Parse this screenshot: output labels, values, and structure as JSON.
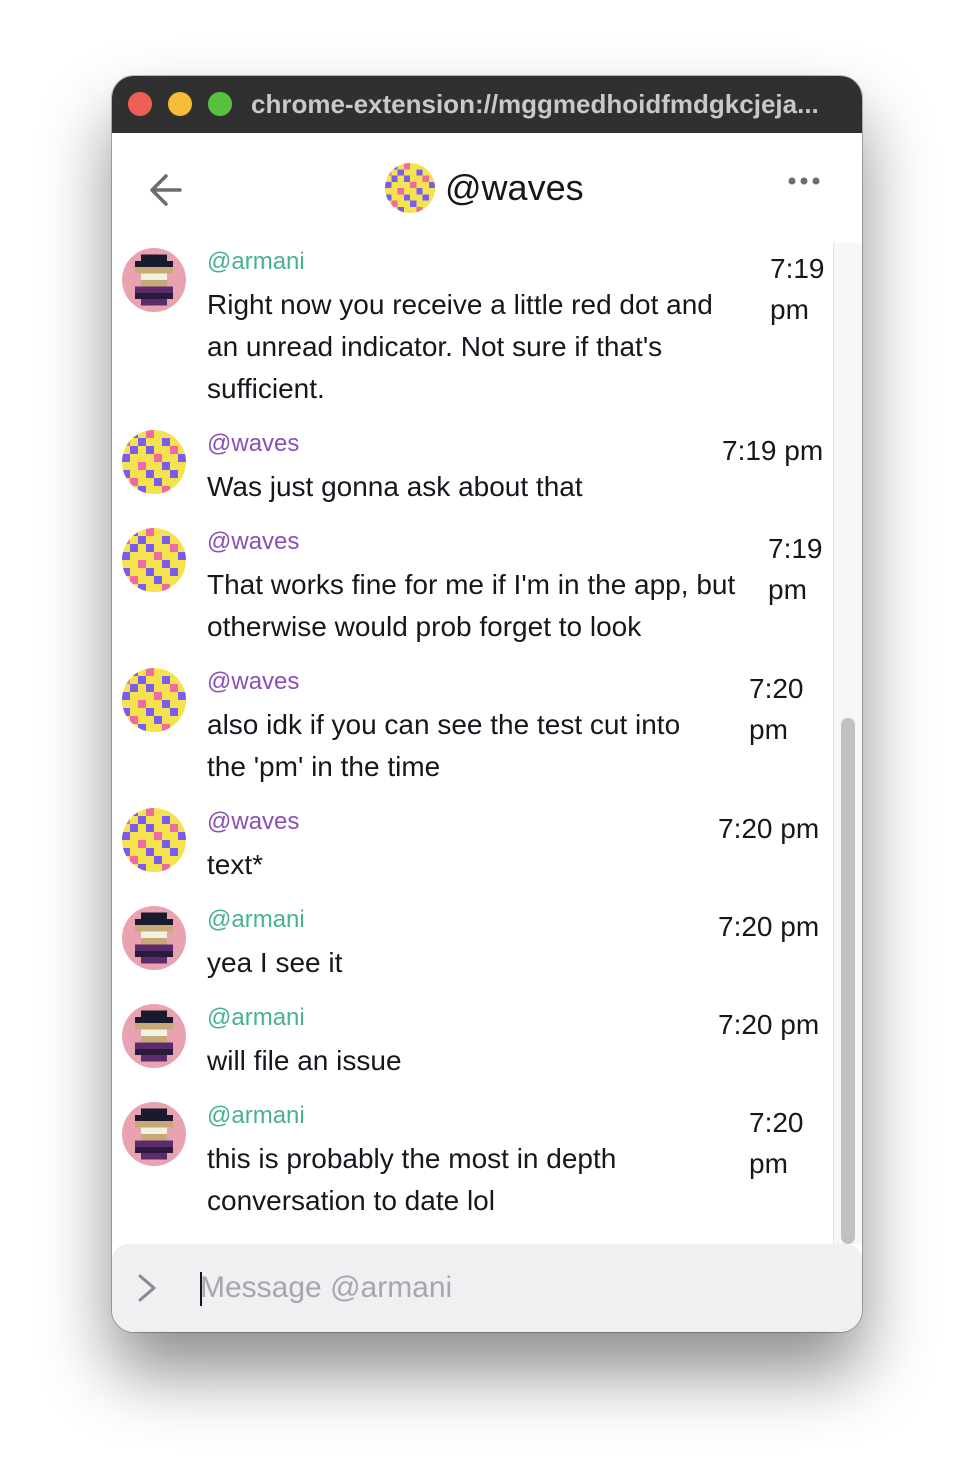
{
  "window": {
    "url": "chrome-extension://mggmedhoidfmdgkcjeja..."
  },
  "header": {
    "title": "@waves",
    "back_icon": "arrow-left-icon",
    "more_icon": "ellipsis-icon"
  },
  "messages": [
    {
      "user": "@armani",
      "text": [
        "Right now you receive a little red dot and",
        "an unread indicator. Not sure if that's",
        "sufficient."
      ],
      "time": [
        "7:19",
        "pm"
      ]
    },
    {
      "user": "@waves",
      "text": [
        "Was just gonna ask about that"
      ],
      "time": [
        "7:19 pm"
      ]
    },
    {
      "user": "@waves",
      "text": [
        "That works fine for me if I'm in the app, but",
        "otherwise would prob forget to look"
      ],
      "time": [
        "7:19",
        "pm"
      ]
    },
    {
      "user": "@waves",
      "text": [
        "also idk if you can see the test cut into",
        "the 'pm' in the time"
      ],
      "time": [
        "7:20",
        "pm"
      ]
    },
    {
      "user": "@waves",
      "text": [
        "text*"
      ],
      "time": [
        "7:20 pm"
      ]
    },
    {
      "user": "@armani",
      "text": [
        "yea I see it"
      ],
      "time": [
        "7:20 pm"
      ]
    },
    {
      "user": "@armani",
      "text": [
        "will file an issue"
      ],
      "time": [
        "7:20 pm"
      ]
    },
    {
      "user": "@armani",
      "text": [
        "this is probably the most in depth",
        "conversation to date lol"
      ],
      "time": [
        "7:20",
        "pm"
      ]
    }
  ],
  "composer": {
    "placeholder": "Message @armani",
    "value": "",
    "prompt_icon": "chevron-right-icon"
  },
  "colors": {
    "armani_name": "#47b38c",
    "waves_name": "#8a4fb8",
    "titlebar": "#303030",
    "composer_bg": "#f0f0f3"
  }
}
